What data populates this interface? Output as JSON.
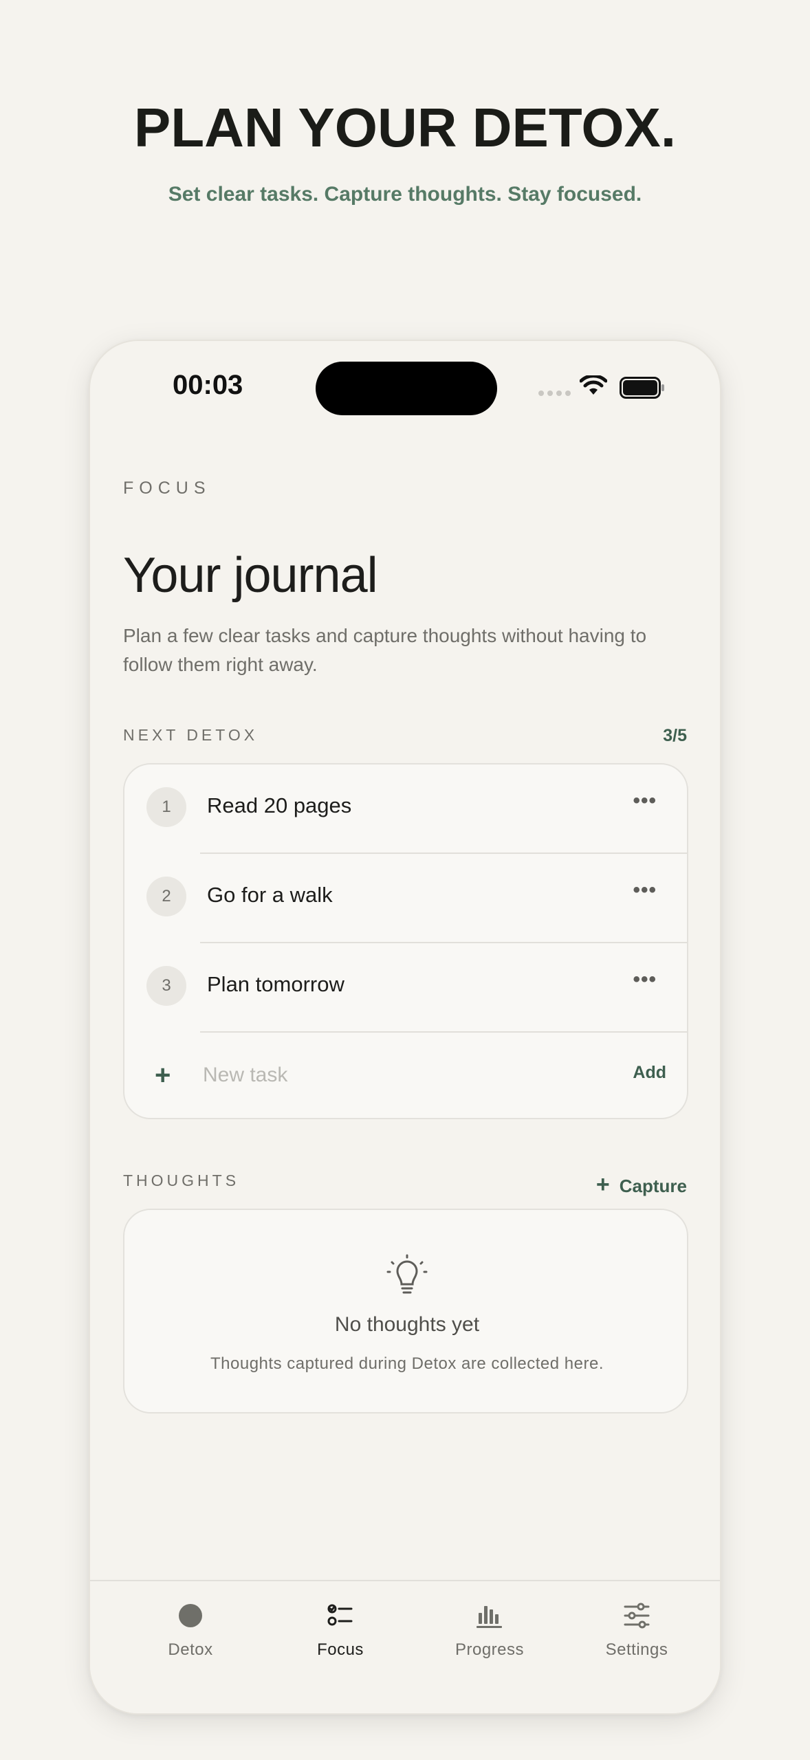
{
  "hero": {
    "title": "PLAN YOUR DETOX.",
    "subtitle": "Set clear tasks. Capture thoughts. Stay focused."
  },
  "status_bar": {
    "time": "00:03"
  },
  "page": {
    "overline": "FOCUS",
    "title": "Your journal",
    "description": "Plan a few clear tasks and capture thoughts without having to follow them right away."
  },
  "next_detox": {
    "label": "NEXT DETOX",
    "counter": "3/5",
    "tasks": [
      {
        "number": "1",
        "label": "Read 20 pages"
      },
      {
        "number": "2",
        "label": "Go for a walk"
      },
      {
        "number": "3",
        "label": "Plan tomorrow"
      }
    ],
    "more_glyph": "•••",
    "new_task_placeholder": "New task",
    "new_task_value": "",
    "add_label": "Add"
  },
  "thoughts": {
    "label": "THOUGHTS",
    "capture_label": "Capture",
    "empty_title": "No thoughts yet",
    "empty_description": "Thoughts captured during Detox are collected here."
  },
  "tabbar": {
    "active": "Focus",
    "tabs": [
      {
        "label": "Detox",
        "icon": "circle-icon"
      },
      {
        "label": "Focus",
        "icon": "checklist-icon"
      },
      {
        "label": "Progress",
        "icon": "bar-chart-icon"
      },
      {
        "label": "Settings",
        "icon": "sliders-icon"
      }
    ]
  },
  "colors": {
    "accent": "#3e5f4f",
    "hero_subtitle": "#567a66",
    "background": "#f5f3ee",
    "card": "#f9f8f5"
  }
}
